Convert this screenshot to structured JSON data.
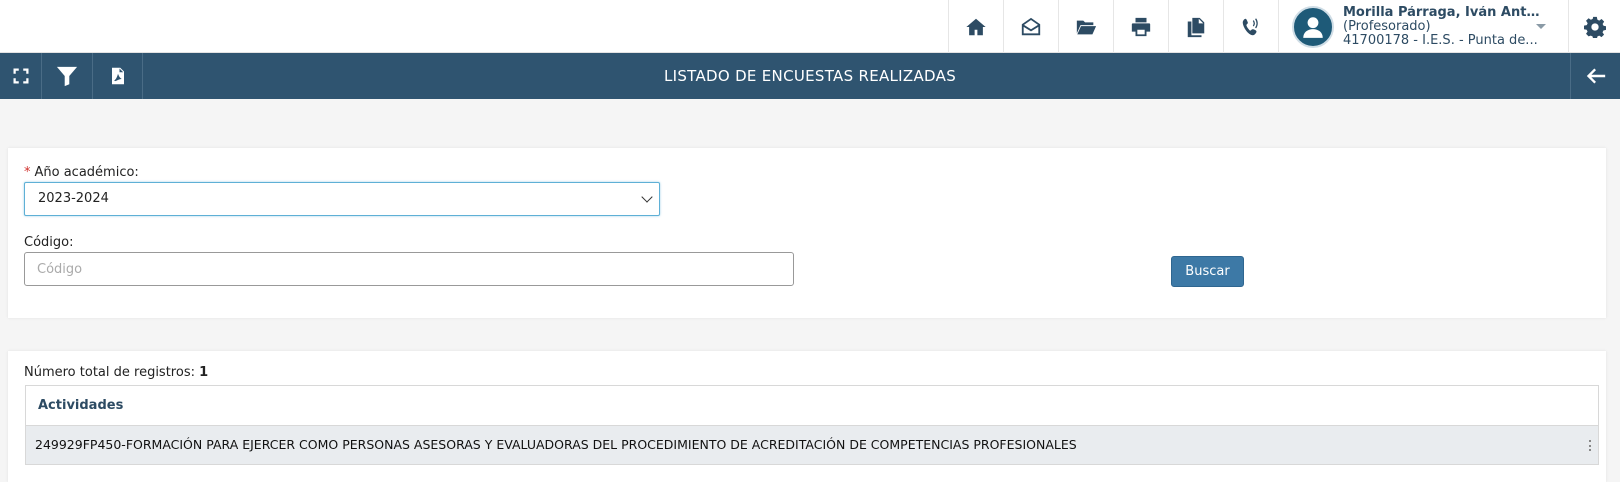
{
  "topbar": {
    "icons": [
      "home-icon",
      "envelope-open-icon",
      "folder-open-icon",
      "print-icon",
      "copy-icon",
      "phone-volume-icon"
    ],
    "user": {
      "name": "Morilla Párraga, Iván Anto...",
      "role": "(Profesorado)",
      "center": "41700178 - I.E.S. - Punta de..."
    },
    "settings_icon": "gear-icon"
  },
  "titlebar": {
    "title": "LISTADO DE ENCUESTAS REALIZADAS",
    "left_icons": [
      "expand-icon",
      "filter-icon",
      "pdf-icon"
    ],
    "back_icon": "arrow-left-icon"
  },
  "filters": {
    "year_label": "Año académico:",
    "year_required": "*",
    "year_value": "2023-2024",
    "code_label": "Código:",
    "code_placeholder": "Código",
    "code_value": "",
    "search_button": "Buscar"
  },
  "results": {
    "total_label": "Número total de registros:",
    "total_count": "1",
    "column_header": "Actividades",
    "rows": [
      "249929FP450-FORMACIÓN PARA EJERCER COMO PERSONAS ASESORAS Y EVALUADORAS DEL PROCEDIMIENTO DE ACREDITACIÓN DE COMPETENCIAS PROFESIONALES"
    ]
  },
  "colors": {
    "header_bar": "#2f5470",
    "accent_button": "#3d79a6",
    "icon_color": "#2d4b63"
  }
}
